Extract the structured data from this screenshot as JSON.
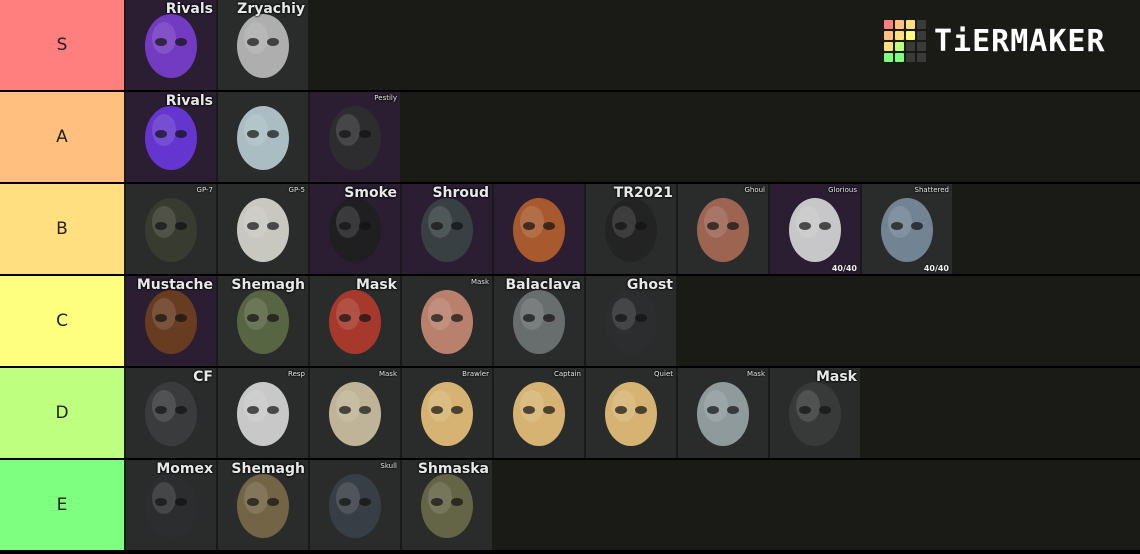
{
  "logo": {
    "text": "TiERMAKER",
    "grid_colors": [
      "#ff7f7f",
      "#ffbf7f",
      "#ffdf7f",
      "#3a3a3a",
      "#ffbf7f",
      "#ffdf7f",
      "#ffff7f",
      "#3a3a3a",
      "#ffdf7f",
      "#bfff7f",
      "#3a3a3a",
      "#3a3a3a",
      "#7fff7f",
      "#7fff7f",
      "#3a3a3a",
      "#3a3a3a"
    ]
  },
  "tiers": [
    {
      "label": "S",
      "color": "#ff7f7f",
      "items": [
        {
          "name": "Rivals",
          "icon": "rivals-mask-icon",
          "bg": "purple",
          "size": "large",
          "face": "#7a3ed0"
        },
        {
          "name": "Zryachiy",
          "icon": "zryachiy-skull-mask-icon",
          "bg": "dark",
          "size": "large",
          "face": "#bdbdbd"
        }
      ]
    },
    {
      "label": "A",
      "color": "#ffbf7f",
      "items": [
        {
          "name": "Rivals",
          "icon": "rivals-bandana-icon",
          "bg": "purple",
          "size": "large",
          "face": "#6a38e0"
        },
        {
          "name": "",
          "icon": "white-beard-icon",
          "bg": "dark",
          "size": "large",
          "face": "#b8cdd4"
        },
        {
          "name": "Pestily",
          "icon": "plague-doctor-mask-icon",
          "bg": "purple",
          "size": "small",
          "face": "#2e2e2e"
        }
      ]
    },
    {
      "label": "B",
      "color": "#ffdf7f",
      "items": [
        {
          "name": "GP-7",
          "icon": "gp7-gas-mask-icon",
          "bg": "dark",
          "size": "small",
          "face": "#3a3d30"
        },
        {
          "name": "GP-5",
          "icon": "gp5-gas-mask-icon",
          "bg": "dark",
          "size": "small",
          "face": "#d9d9d2"
        },
        {
          "name": "Smoke",
          "icon": "smoke-balaclava-icon",
          "bg": "purple",
          "size": "large",
          "face": "#1e1e1e"
        },
        {
          "name": "Shroud",
          "icon": "shroud-mask-icon",
          "bg": "purple",
          "size": "large",
          "face": "#3a4446"
        },
        {
          "name": "",
          "icon": "red-beard-icon",
          "bg": "purple",
          "size": "large",
          "face": "#b6612e"
        },
        {
          "name": "TR2021",
          "icon": "tr2021-balaclava-icon",
          "bg": "dark",
          "size": "large",
          "face": "#222222"
        },
        {
          "name": "Ghoul",
          "icon": "ghoul-mask-icon",
          "bg": "dark",
          "size": "small",
          "face": "#a86a55"
        },
        {
          "name": "Glorious",
          "icon": "glorious-mask-icon",
          "bg": "purple",
          "size": "small",
          "face": "#d8d8d8",
          "corner": "40/40"
        },
        {
          "name": "Shattered",
          "icon": "shattered-mask-icon",
          "bg": "dark",
          "size": "small",
          "face": "#7a8da0",
          "corner": "40/40"
        }
      ]
    },
    {
      "label": "C",
      "color": "#ffff7f",
      "items": [
        {
          "name": "Mustache",
          "icon": "mustache-icon",
          "bg": "purple",
          "size": "large",
          "face": "#6e3f1e"
        },
        {
          "name": "Shemagh",
          "icon": "shemagh-green-icon",
          "bg": "dark",
          "size": "large",
          "face": "#5d6b45"
        },
        {
          "name": "Mask",
          "icon": "red-half-mask-icon",
          "bg": "dark",
          "size": "large",
          "face": "#b53a2c"
        },
        {
          "name": "Mask",
          "icon": "pink-face-mask-icon",
          "bg": "dark",
          "size": "small",
          "face": "#c98a74"
        },
        {
          "name": "Balaclava",
          "icon": "balaclava-icon",
          "bg": "dark",
          "size": "large",
          "face": "#6f7476"
        },
        {
          "name": "Ghost",
          "icon": "ghost-balaclava-icon",
          "bg": "dark",
          "size": "large",
          "face": "#2c2e30"
        }
      ]
    },
    {
      "label": "D",
      "color": "#bfff7f",
      "items": [
        {
          "name": "CF",
          "icon": "cf-balaclava-icon",
          "bg": "dark",
          "size": "large",
          "face": "#3b3d3f"
        },
        {
          "name": "Resp",
          "icon": "respirator-icon",
          "bg": "dark",
          "size": "small",
          "face": "#d9d9d9"
        },
        {
          "name": "Mask",
          "icon": "hockey-mask-icon",
          "bg": "dark",
          "size": "small",
          "face": "#cfc3a3"
        },
        {
          "name": "Brawler",
          "icon": "brawler-clown-icon",
          "bg": "dark",
          "size": "small",
          "face": "#e9c27a"
        },
        {
          "name": "Captain",
          "icon": "captain-clown-icon",
          "bg": "dark",
          "size": "small",
          "face": "#e9c27a"
        },
        {
          "name": "Quiet",
          "icon": "quiet-clown-icon",
          "bg": "dark",
          "size": "small",
          "face": "#e9c27a"
        },
        {
          "name": "Mask",
          "icon": "myers-mask-icon",
          "bg": "dark",
          "size": "small",
          "face": "#9aa6a8"
        },
        {
          "name": "Mask",
          "icon": "black-bandana-icon",
          "bg": "dark",
          "size": "large",
          "face": "#3a3c3c"
        }
      ]
    },
    {
      "label": "E",
      "color": "#7fff7f",
      "items": [
        {
          "name": "Momex",
          "icon": "momex-balaclava-icon",
          "bg": "dark",
          "size": "large",
          "face": "#2b2d2f"
        },
        {
          "name": "Shemagh",
          "icon": "shemagh-camo-icon",
          "bg": "dark",
          "size": "large",
          "face": "#7a6a48"
        },
        {
          "name": "Skull",
          "icon": "skull-mask-icon",
          "bg": "dark",
          "size": "small",
          "face": "#3a4048"
        },
        {
          "name": "Shmaska",
          "icon": "shmaska-camo-icon",
          "bg": "dark",
          "size": "large",
          "face": "#6a6a4a"
        }
      ]
    }
  ]
}
